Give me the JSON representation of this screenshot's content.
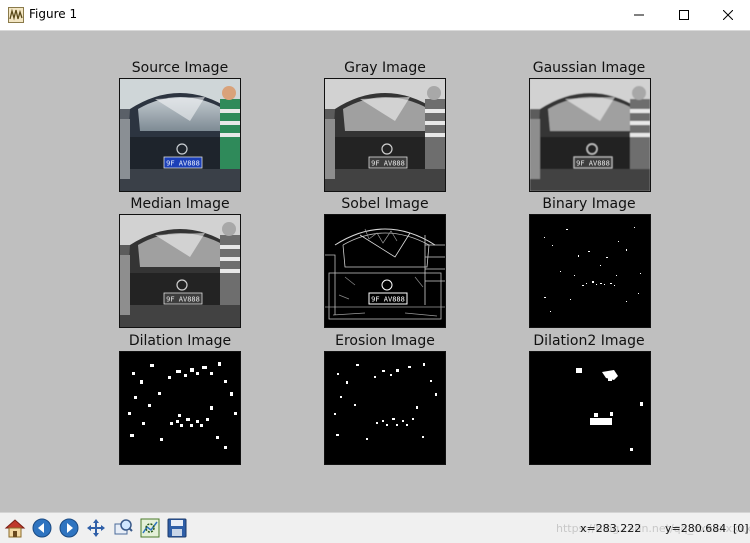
{
  "window": {
    "title": "Figure 1"
  },
  "panels": [
    {
      "title": "Source Image",
      "plate": "9F AV888"
    },
    {
      "title": "Gray Image",
      "plate": "9F AV888"
    },
    {
      "title": "Gaussian Image",
      "plate": "9F AV888"
    },
    {
      "title": "Median Image",
      "plate": "9F AV888"
    },
    {
      "title": "Sobel Image",
      "plate": "9F AV888"
    },
    {
      "title": "Binary Image"
    },
    {
      "title": "Dilation Image"
    },
    {
      "title": "Erosion Image"
    },
    {
      "title": "Dilation2 Image"
    }
  ],
  "toolbar": {
    "buttons": [
      "home-icon",
      "back-icon",
      "forward-icon",
      "pan-icon",
      "zoom-icon",
      "configure-subplots-icon",
      "save-icon"
    ]
  },
  "status": {
    "watermark": "https://blog.csdn.net/qq_xxxxxxxxx",
    "x_readout": "x=283.222",
    "y_readout": "y=280.684",
    "value_readout": "[0]"
  },
  "colors": {
    "canvas_bg": "#bfbfbf",
    "plate_blue": "#1b3fb8",
    "toolbar_bg": "#f0f0f0"
  }
}
